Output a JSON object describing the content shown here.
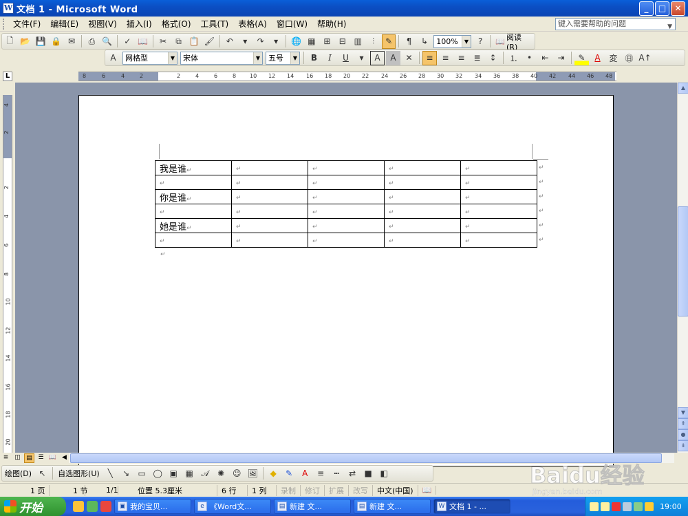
{
  "window": {
    "title": "文档 1 - Microsoft Word",
    "buttons": {
      "minimize": "_",
      "maximize": "□",
      "close": "✕"
    }
  },
  "menubar": {
    "items": [
      "文件(F)",
      "编辑(E)",
      "视图(V)",
      "插入(I)",
      "格式(O)",
      "工具(T)",
      "表格(A)",
      "窗口(W)",
      "帮助(H)"
    ],
    "help_placeholder": "键入需要帮助的问题"
  },
  "toolbar_standard": {
    "zoom": "100%",
    "read_label": "阅读(R)"
  },
  "toolbar_format": {
    "style": "网格型",
    "font": "宋体",
    "size": "五号"
  },
  "ruler": {
    "h_ticks": [
      "8",
      "6",
      "4",
      "2",
      "2",
      "4",
      "6",
      "8",
      "10",
      "12",
      "14",
      "16",
      "18",
      "20",
      "22",
      "24",
      "26",
      "28",
      "30",
      "32",
      "34",
      "36",
      "38",
      "40",
      "42",
      "44",
      "46",
      "48"
    ],
    "v_ticks": [
      "4",
      "2",
      "2",
      "4",
      "6",
      "8",
      "10",
      "12",
      "14",
      "16",
      "18",
      "20"
    ]
  },
  "document": {
    "table": [
      [
        "我是谁",
        "",
        "",
        "",
        ""
      ],
      [
        "",
        "",
        "",
        "",
        ""
      ],
      [
        "你是谁",
        "",
        "",
        "",
        ""
      ],
      [
        "",
        "",
        "",
        "",
        ""
      ],
      [
        "她是谁",
        "",
        "",
        "",
        ""
      ],
      [
        "",
        "",
        "",
        "",
        ""
      ]
    ],
    "paragraph_mark": "↵"
  },
  "drawing_toolbar": {
    "draw_label": "绘图(D)",
    "autoshape_label": "自选图形(U)"
  },
  "statusbar": {
    "page": "1 页",
    "section": "1 节",
    "page_of": "1/1",
    "position": "位置 5.3厘米",
    "line": "6 行",
    "column": "1 列",
    "rec": "录制",
    "trk": "修订",
    "ext": "扩展",
    "ovr": "改写",
    "lang": "中文(中国)"
  },
  "taskbar": {
    "start_label": "开始",
    "tasks": [
      "我的宝贝...",
      "《Word文...",
      "新建 文...",
      "新建 文...",
      "文档 1 - ..."
    ],
    "clock": "19:00"
  },
  "watermark": {
    "brand": "Baidu经验",
    "url": "jingyan.baidu.com"
  },
  "colors": {
    "titlebar": "#0a5fd8",
    "doc_background": "#8a95aa",
    "active_button": "#f5c46a",
    "taskbar": "#245ddb",
    "start_button": "#2e912e"
  }
}
